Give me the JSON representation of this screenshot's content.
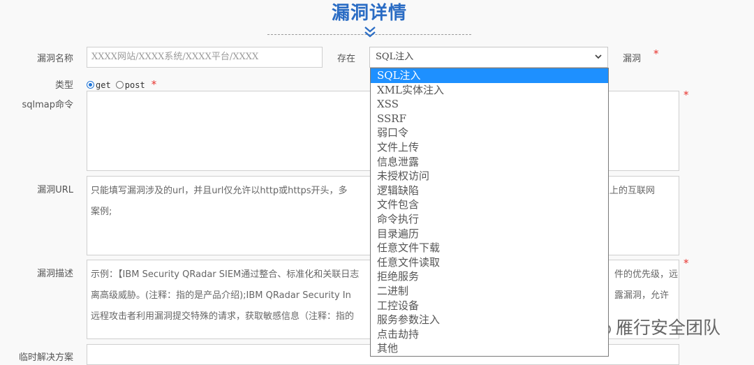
{
  "page": {
    "title": "漏洞详情"
  },
  "form": {
    "name_label": "漏洞名称",
    "name_placeholder": "XXXX网站/XXXX系统/XXXX平台/XXXX",
    "exists_label": "存在",
    "exists_value": "SQL注入",
    "vuln_suffix": "漏洞",
    "required_mark": "*",
    "type_label": "类型",
    "type_options": [
      {
        "label": "get",
        "selected": true
      },
      {
        "label": "post",
        "selected": false
      }
    ],
    "sqlmap_label": "sqlmap命令",
    "url_label": "漏洞URL",
    "url_placeholder_part1": "只能填写漏洞涉及的url，并且url仅允许以http或https开头，多",
    "url_placeholder_part2": "以上的互联网",
    "url_placeholder_line2": "案例;",
    "desc_label": "漏洞描述",
    "desc_line1_a": "示例：【IBM Security QRadar SIEM通过整合、标准化和关联日志",
    "desc_line1_b": "件的优先级，远",
    "desc_line2_a": "离高级威胁。(注释：指的是产品介绍);IBM QRadar Security In",
    "desc_line2_b": "露漏洞，允许",
    "desc_line3_a": "远程攻击者利用漏洞提交特殊的请求，获取敏感信息（注释：指的",
    "temp_fix_label": "临时解决方案"
  },
  "dropdown": {
    "options": [
      "SQL注入",
      "XML实体注入",
      "XSS",
      "SSRF",
      "弱口令",
      "文件上传",
      "信息泄露",
      "未授权访问",
      "逻辑缺陷",
      "文件包含",
      "命令执行",
      "目录遍历",
      "任意文件下载",
      "任意文件读取",
      "拒绝服务",
      "二进制",
      "工控设备",
      "服务参数注入",
      "点击劫持",
      "其他"
    ],
    "selected_index": 0
  },
  "watermark": {
    "text": "雁行安全团队",
    "icon": "wechat-icon"
  },
  "colors": {
    "title": "#2a6cc4",
    "selected": "#1e90ff",
    "required": "#e8332e"
  }
}
